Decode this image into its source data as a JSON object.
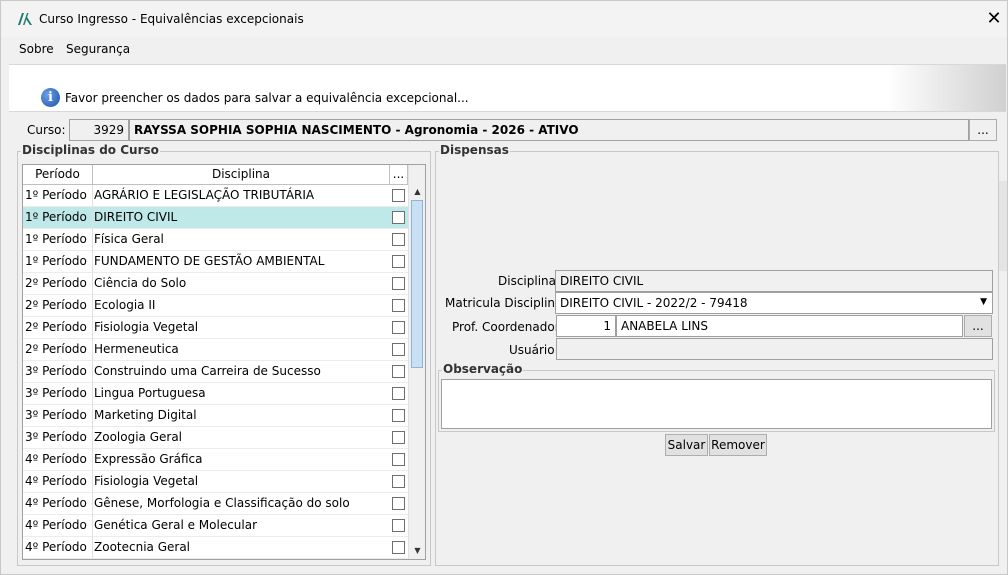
{
  "window": {
    "title": "Curso Ingresso - Equivalências excepcionais",
    "close_glyph": "✕"
  },
  "menu": {
    "items": [
      "Sobre",
      "Segurança"
    ]
  },
  "banner": {
    "message": "Favor preencher os dados para salvar a equivalência excepcional..."
  },
  "curso": {
    "label": "Curso:",
    "code": "3929",
    "description": "RAYSSA SOPHIA SOPHIA NASCIMENTO - Agronomia - 2026 - ATIVO",
    "lookup_label": "..."
  },
  "disciplinas_group": {
    "title": "Disciplinas do Curso",
    "columns": [
      "Período",
      "Disciplina",
      "..."
    ],
    "rows": [
      {
        "periodo": "1º Período",
        "disciplina": "AGRÁRIO E LEGISLAÇÃO TRIBUTÁRIA",
        "checked": false,
        "selected": false
      },
      {
        "periodo": "1º Período",
        "disciplina": "DIREITO CIVIL",
        "checked": false,
        "selected": true
      },
      {
        "periodo": "1º Período",
        "disciplina": "Física Geral",
        "checked": false,
        "selected": false
      },
      {
        "periodo": "1º Período",
        "disciplina": "FUNDAMENTO DE GESTÃO AMBIENTAL",
        "checked": false,
        "selected": false
      },
      {
        "periodo": "2º Período",
        "disciplina": "Ciência do Solo",
        "checked": false,
        "selected": false
      },
      {
        "periodo": "2º Período",
        "disciplina": "Ecologia II",
        "checked": false,
        "selected": false
      },
      {
        "periodo": "2º Período",
        "disciplina": "Fisiologia Vegetal",
        "checked": false,
        "selected": false
      },
      {
        "periodo": "2º Período",
        "disciplina": "Hermeneutica",
        "checked": false,
        "selected": false
      },
      {
        "periodo": "3º Período",
        "disciplina": "Construindo uma Carreira de Sucesso",
        "checked": false,
        "selected": false
      },
      {
        "periodo": "3º Período",
        "disciplina": "Lingua Portuguesa",
        "checked": false,
        "selected": false
      },
      {
        "periodo": "3º Período",
        "disciplina": "Marketing Digital",
        "checked": false,
        "selected": false
      },
      {
        "periodo": "3º Período",
        "disciplina": "Zoologia Geral",
        "checked": false,
        "selected": false
      },
      {
        "periodo": "4º Período",
        "disciplina": "Expressão Gráfica",
        "checked": false,
        "selected": false
      },
      {
        "periodo": "4º Período",
        "disciplina": "Fisiologia Vegetal",
        "checked": false,
        "selected": false
      },
      {
        "periodo": "4º Período",
        "disciplina": "Gênese, Morfologia e Classificação do solo",
        "checked": false,
        "selected": false
      },
      {
        "periodo": "4º Período",
        "disciplina": "Genética Geral e Molecular",
        "checked": false,
        "selected": false
      },
      {
        "periodo": "4º Período",
        "disciplina": "Zootecnia Geral",
        "checked": false,
        "selected": false
      }
    ]
  },
  "dispensas": {
    "title": "Dispensas",
    "disciplina_label": "Disciplina:",
    "disciplina_value": "DIREITO CIVIL",
    "matricula_label": "Matricula Disciplina:",
    "matricula_value": "DIREITO CIVIL - 2022/2 - 79418",
    "prof_label": "Prof. Coordenador:",
    "prof_code": "1",
    "prof_name": "ANABELA LINS",
    "prof_lookup_label": "...",
    "usuario_label": "Usuário:",
    "usuario_value": "",
    "observacao_title": "Observação",
    "observacao_value": "",
    "salvar_label": "Salvar",
    "remover_label": "Remover"
  }
}
